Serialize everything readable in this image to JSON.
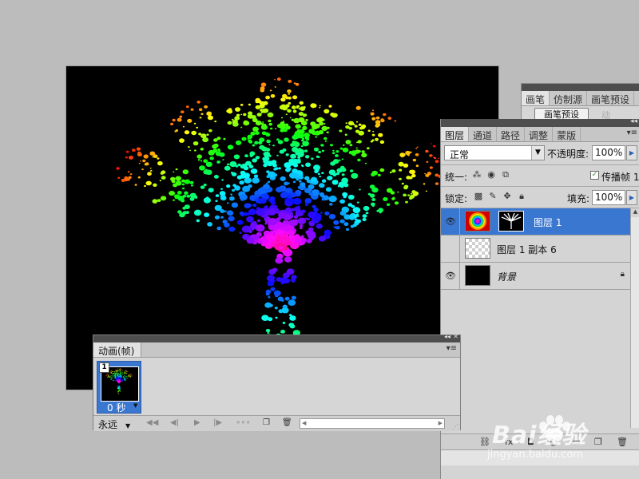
{
  "brush_panel": {
    "tabs": [
      "画笔",
      "仿制源",
      "画笔预设"
    ],
    "preset_button": "画笔预设",
    "faded_label": "动"
  },
  "layers_panel": {
    "tabs": [
      "图层",
      "通道",
      "路径",
      "调整",
      "蒙版"
    ],
    "blend_mode": "正常",
    "opacity_label": "不透明度:",
    "opacity_value": "100%",
    "unify_label": "统一:",
    "propagate_label": "传播帧 1",
    "lock_label": "锁定:",
    "fill_label": "填充:",
    "fill_value": "100%",
    "layers": [
      {
        "name": "图层 1",
        "visible": true,
        "selected": true,
        "thumb": "rainbow",
        "has_mask": true
      },
      {
        "name": "图层 1 副本 6",
        "visible": false,
        "selected": false,
        "thumb": "transparent"
      },
      {
        "name": "背景",
        "visible": true,
        "selected": false,
        "thumb": "black",
        "locked": true
      }
    ]
  },
  "animation_panel": {
    "tab_label": "动画(帧)",
    "frames": [
      {
        "number": "1",
        "delay": "0 秒",
        "selected": true
      }
    ],
    "loop_option": "永远"
  },
  "watermark": {
    "brand": "Bai经验",
    "url": "jingyan.baidu.com"
  },
  "colors": {
    "selection_blue": "#3a77d0",
    "panel_bg": "#d4d4d4",
    "titlebar": "#4e4e4e",
    "workspace": "#bcbcbc"
  }
}
